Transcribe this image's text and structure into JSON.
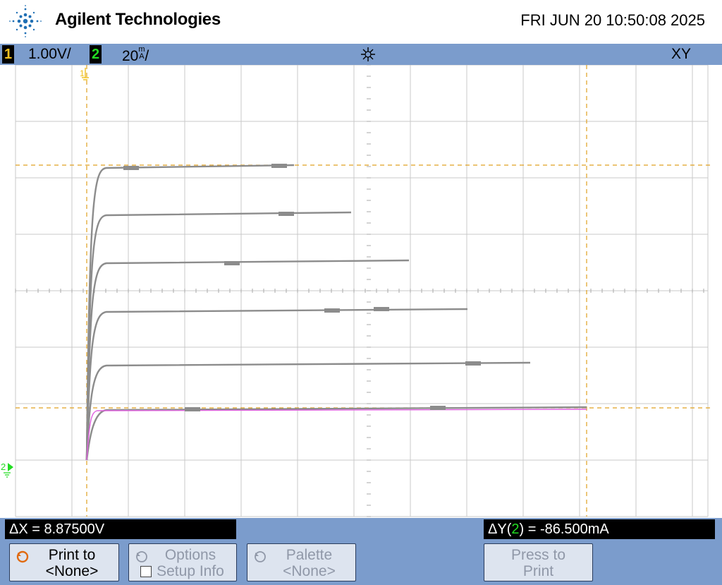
{
  "header": {
    "brand": "Agilent Technologies",
    "datetime": "FRI JUN 20 10:50:08 2025",
    "logo_icon": "agilent-spark-icon"
  },
  "statusbar": {
    "ch1_number": "1",
    "ch1_scale": "1.00V/",
    "ch2_number": "2",
    "ch2_scale": "20",
    "ch2_units_top": "m",
    "ch2_units_bottom": "A",
    "ch2_slash": "/",
    "trigger_icon": "trigger-status-icon",
    "mode": "XY",
    "ch1_color": "#f0c020",
    "ch2_color": "#22dd22"
  },
  "markers": {
    "ch1_label": "1",
    "ch2_label": "2"
  },
  "trace_colors": {
    "grey_trace": "#8c8c8c",
    "pink_trace": "#e060e0",
    "cursor_color": "#e0a020",
    "grid_color": "#c8c8c8"
  },
  "readouts": {
    "dx": "ΔX = 8.87500V",
    "dy_prefix": "ΔY(",
    "dy_channel": "2",
    "dy_suffix": ") = -86.500mA"
  },
  "softkeys": [
    {
      "line1": "Print to",
      "line2": "<None>",
      "enabled": true
    },
    {
      "line1": "Options",
      "line2": "Setup Info",
      "enabled": false
    },
    {
      "line1": "Palette",
      "line2": "<None>",
      "enabled": false
    },
    {
      "line1": "Press to",
      "line2": "Print",
      "enabled": false
    }
  ]
}
